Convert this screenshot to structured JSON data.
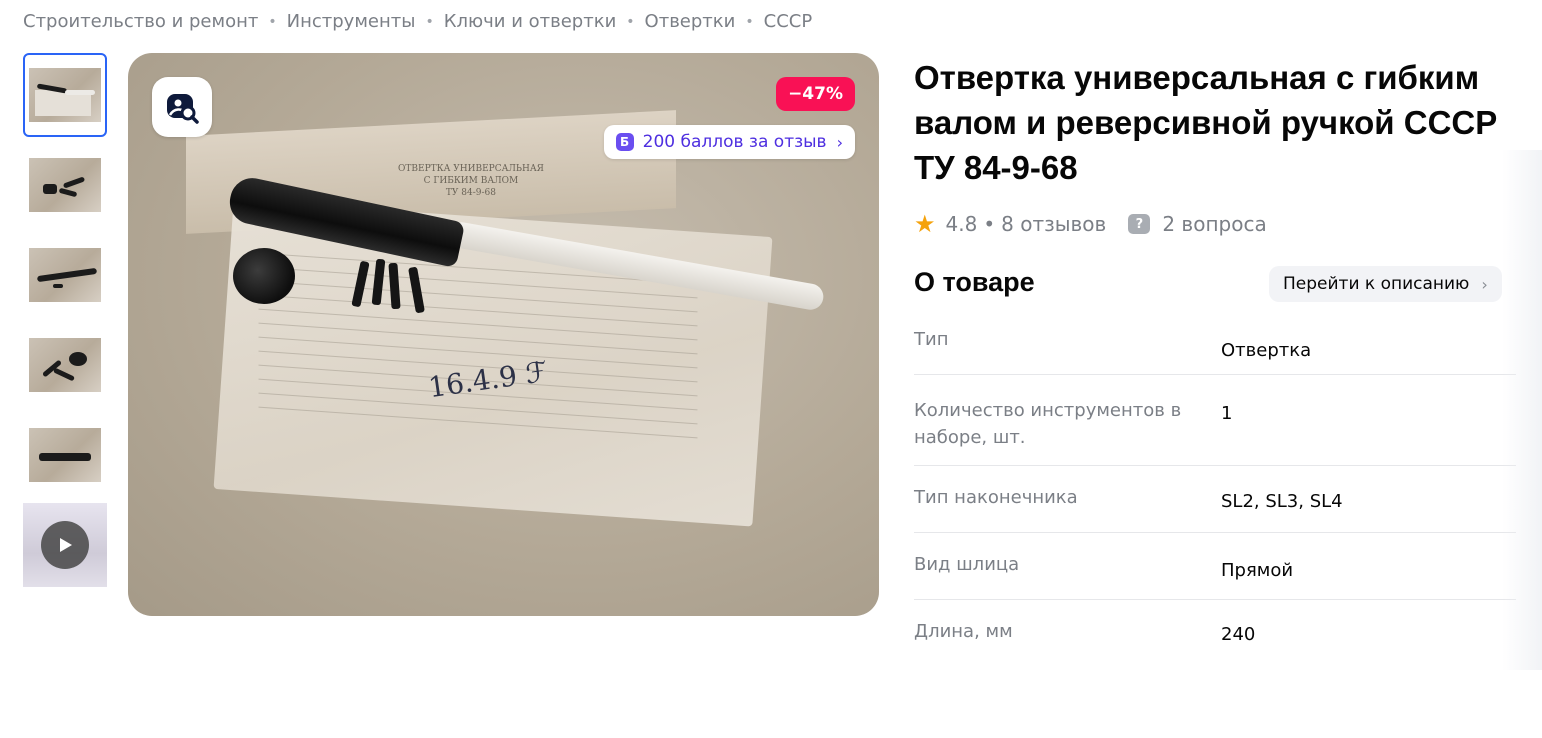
{
  "breadcrumb": [
    "Строительство и ремонт",
    "Инструменты",
    "Ключи и отвертки",
    "Отвертки",
    "СССР"
  ],
  "gallery": {
    "thumbnails": [
      "photo-1",
      "photo-2",
      "photo-3",
      "photo-4",
      "photo-5",
      "video"
    ],
    "active_index": 0,
    "discount_label": "−47%",
    "bonus_label": "200 баллов за отзыв",
    "bonus_icon_letter": "Б",
    "box_text": "ОТВЕРТКА УНИВЕРСАЛЬНАЯ\nС ГИБКИМ ВАЛОМ\nТУ 84-9-68"
  },
  "product": {
    "title": "Отвертка универсальная с гибким валом и реверсивной ручкой СССР ТУ 84-9-68",
    "rating": "4.8",
    "reviews": "8 отзывов",
    "questions": "2 вопроса"
  },
  "about": {
    "heading": "О товаре",
    "goto_label": "Перейти к описанию",
    "specs": [
      {
        "key": "Тип",
        "value": "Отвертка"
      },
      {
        "key": "Количество инструментов в наборе, шт.",
        "value": "1"
      },
      {
        "key": "Тип наконечника",
        "value": "SL2, SL3, SL4"
      },
      {
        "key": "Вид шлица",
        "value": "Прямой"
      },
      {
        "key": "Длина, мм",
        "value": "240"
      }
    ]
  },
  "colors": {
    "discount_bg": "#f91155",
    "bonus_text": "#4e2fe0",
    "active_thumb_border": "#2a64f6",
    "star": "#f5a20b"
  }
}
